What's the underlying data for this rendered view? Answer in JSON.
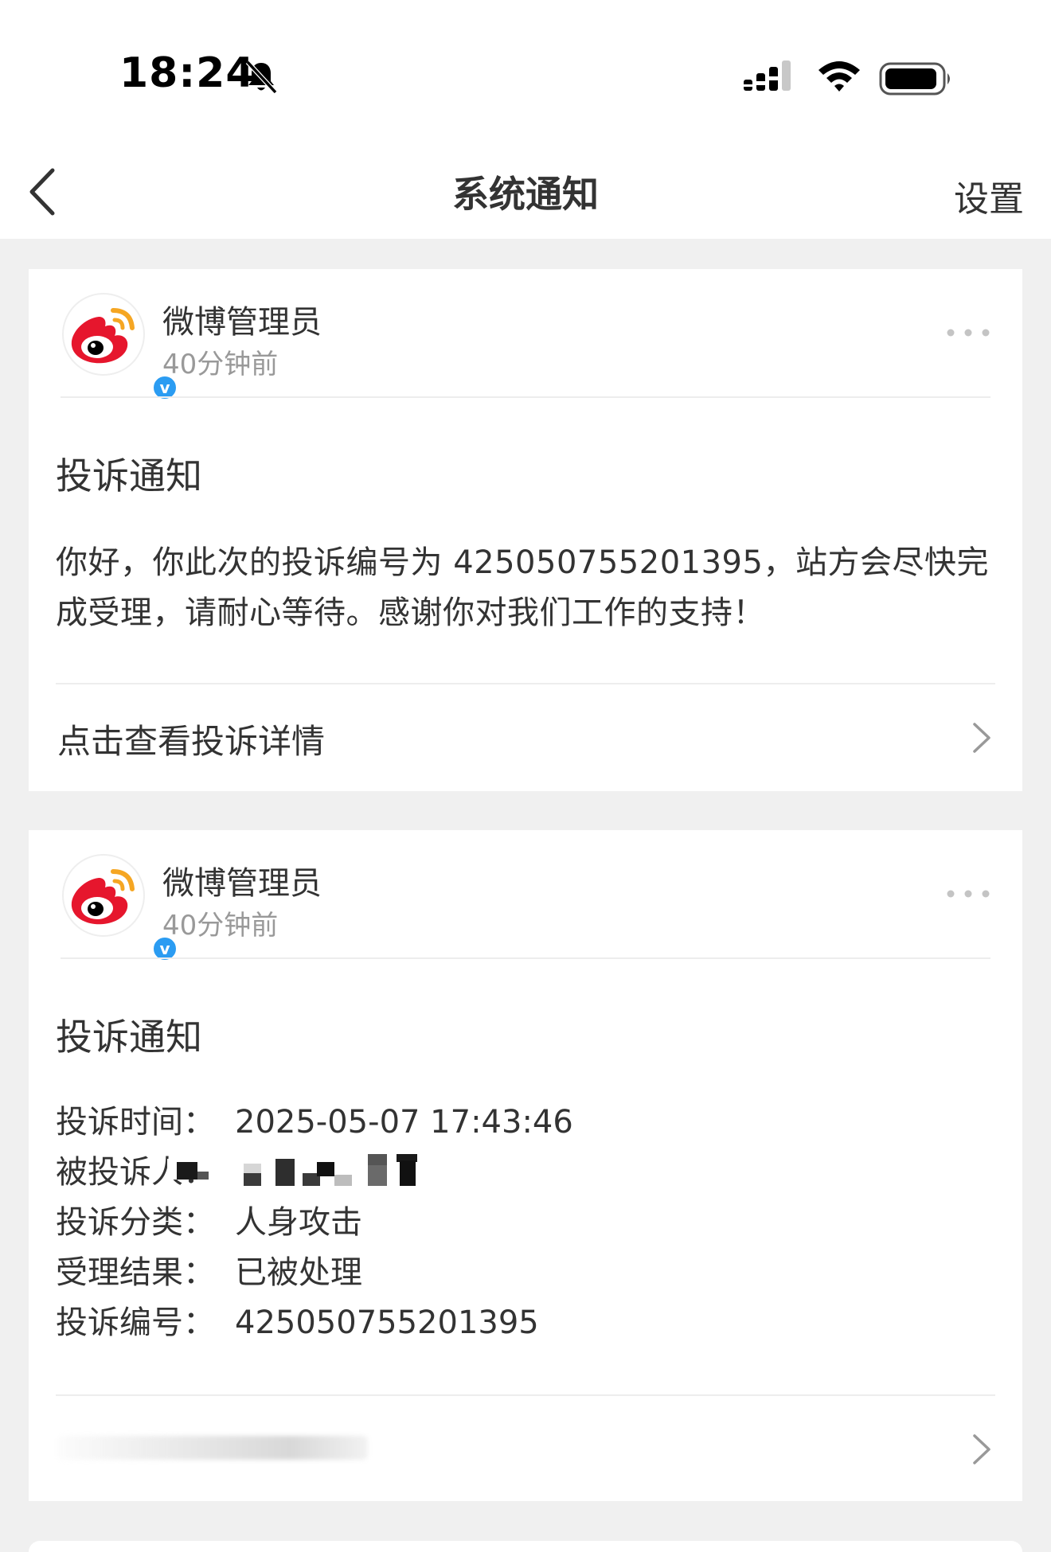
{
  "status_bar": {
    "time": "18:24",
    "icons": [
      "bell-slash-icon",
      "signal-icon",
      "wifi-icon",
      "battery-icon"
    ]
  },
  "nav": {
    "title": "系统通知",
    "settings_label": "设置",
    "back_icon": "chevron-left-icon"
  },
  "notifications": [
    {
      "sender": "微博管理员",
      "time": "40分钟前",
      "title": "投诉通知",
      "body": "你好，你此次的投诉编号为 425050755201395，站方会尽快完成受理，请耐心等待。感谢你对我们工作的支持！",
      "link_label": "点击查看投诉详情"
    },
    {
      "sender": "微博管理员",
      "time": "40分钟前",
      "title": "投诉通知",
      "details": [
        {
          "label": "投诉时间：",
          "value": "2025-05-07 17:43:46"
        },
        {
          "label": "被投诉人：",
          "value": ""
        },
        {
          "label": "投诉分类：",
          "value": "人身攻击"
        },
        {
          "label": "受理结果：",
          "value": "已被处理"
        },
        {
          "label": "投诉编号：",
          "value": "425050755201395"
        }
      ],
      "link_label": ""
    }
  ],
  "colors": {
    "background": "#f0f0f0",
    "card": "#ffffff",
    "text": "#333333",
    "muted": "#999999",
    "weibo_red": "#e6162d",
    "weibo_orange": "#f5a623",
    "verified_blue": "#2b9cf2"
  }
}
